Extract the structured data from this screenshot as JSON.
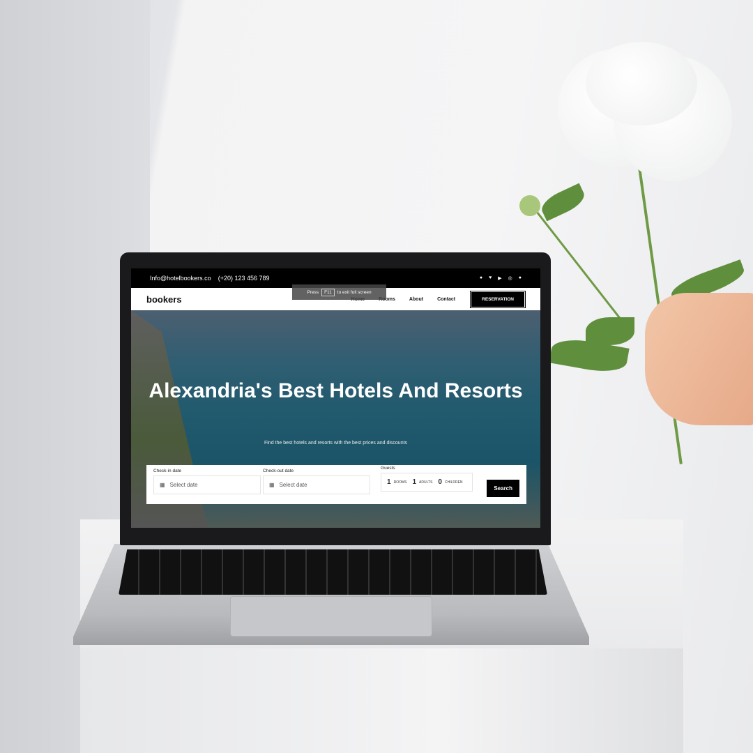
{
  "topbar": {
    "email": "Info@hotelbookers.co",
    "phone": "(+20) 123 456 789",
    "social_icons": [
      "facebook-icon",
      "twitter-icon",
      "youtube-icon",
      "whatsapp-icon",
      "pinterest-icon"
    ]
  },
  "nav": {
    "logo": "bookers",
    "links": [
      "Home",
      "Rooms",
      "About",
      "Contact"
    ],
    "reservation": "RESERVATION"
  },
  "fullscreen_toast": {
    "press": "Press",
    "key": "F11",
    "rest": "to exit full screen"
  },
  "hero": {
    "title": "Alexandria's Best Hotels And Resorts",
    "subtitle": "Find the best hotels and resorts with the best prices and discounts"
  },
  "search": {
    "checkin": {
      "label": "Check-in date",
      "placeholder": "Select date"
    },
    "checkout": {
      "label": "Check-out date",
      "placeholder": "Select date"
    },
    "guests": {
      "label": "Guests",
      "rooms": "1",
      "rooms_label": "ROOMS",
      "adults": "1",
      "adults_label": "ADULTS",
      "children": "0",
      "children_label": "CHILDREN"
    },
    "button": "Search"
  }
}
